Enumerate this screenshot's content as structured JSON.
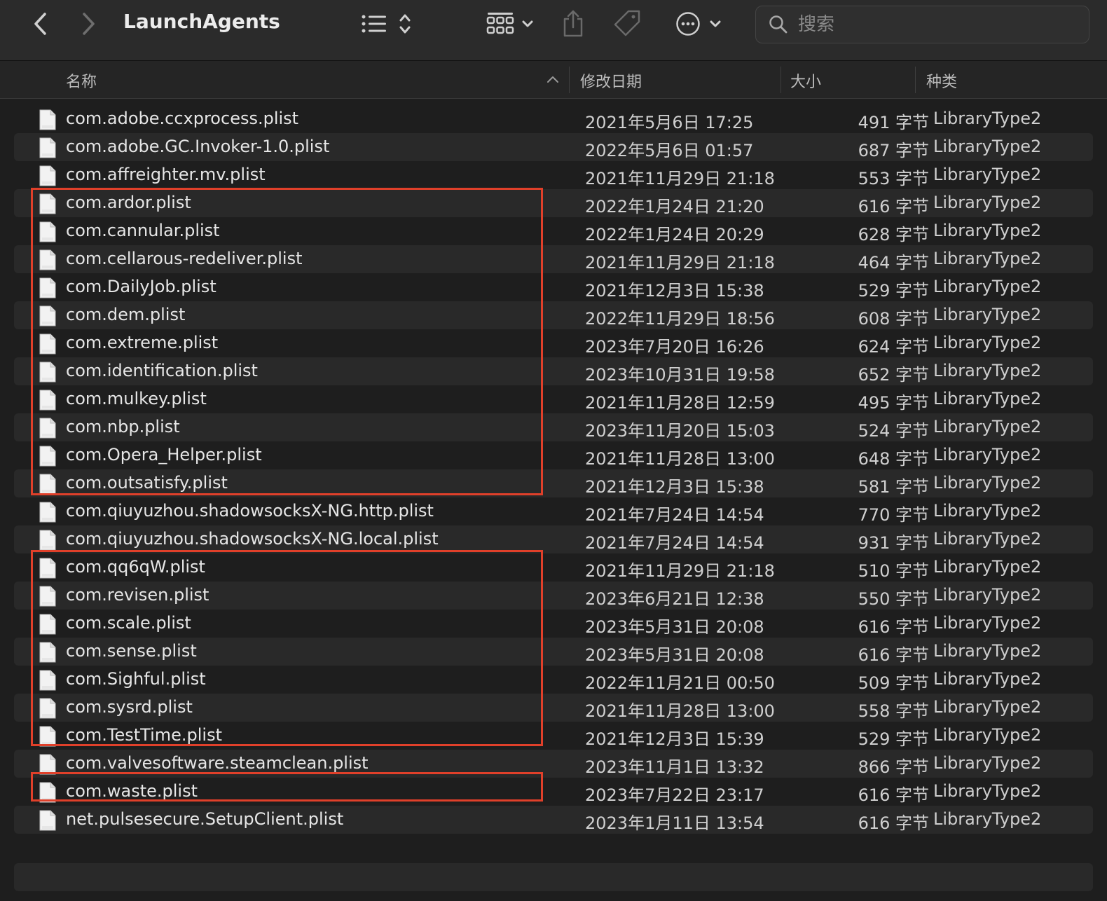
{
  "window": {
    "title": "LaunchAgents"
  },
  "icons": {
    "back": "chevron-left-icon",
    "forward": "chevron-right-icon",
    "list_view": "list-icon",
    "sort": "updown-chevron-icon",
    "grid": "grid-icon",
    "share": "share-icon",
    "tag": "tag-icon",
    "more": "ellipsis-circle-icon",
    "search": "search-icon",
    "file": "plist-file-icon"
  },
  "search": {
    "placeholder": "搜索",
    "value": ""
  },
  "columns": {
    "name": "名称",
    "modified": "修改日期",
    "size": "大小",
    "kind": "种类"
  },
  "files": [
    {
      "name": "com.adobe.ccxprocess.plist",
      "date": "2021年5月6日 17:25",
      "size": "491 字节",
      "kind": "LibraryType2"
    },
    {
      "name": "com.adobe.GC.Invoker-1.0.plist",
      "date": "2022年5月6日 01:57",
      "size": "687 字节",
      "kind": "LibraryType2"
    },
    {
      "name": "com.affreighter.mv.plist",
      "date": "2021年11月29日 21:18",
      "size": "553 字节",
      "kind": "LibraryType2"
    },
    {
      "name": "com.ardor.plist",
      "date": "2022年1月24日 21:20",
      "size": "616 字节",
      "kind": "LibraryType2"
    },
    {
      "name": "com.cannular.plist",
      "date": "2022年1月24日 20:29",
      "size": "628 字节",
      "kind": "LibraryType2"
    },
    {
      "name": "com.cellarous-redeliver.plist",
      "date": "2021年11月29日 21:18",
      "size": "464 字节",
      "kind": "LibraryType2"
    },
    {
      "name": "com.DailyJob.plist",
      "date": "2021年12月3日 15:38",
      "size": "529 字节",
      "kind": "LibraryType2"
    },
    {
      "name": "com.dem.plist",
      "date": "2022年11月29日 18:56",
      "size": "608 字节",
      "kind": "LibraryType2"
    },
    {
      "name": "com.extreme.plist",
      "date": "2023年7月20日 16:26",
      "size": "624 字节",
      "kind": "LibraryType2"
    },
    {
      "name": "com.identification.plist",
      "date": "2023年10月31日 19:58",
      "size": "652 字节",
      "kind": "LibraryType2"
    },
    {
      "name": "com.mulkey.plist",
      "date": "2021年11月28日 12:59",
      "size": "495 字节",
      "kind": "LibraryType2"
    },
    {
      "name": "com.nbp.plist",
      "date": "2023年11月20日 15:03",
      "size": "524 字节",
      "kind": "LibraryType2"
    },
    {
      "name": "com.Opera_Helper.plist",
      "date": "2021年11月28日 13:00",
      "size": "648 字节",
      "kind": "LibraryType2"
    },
    {
      "name": "com.outsatisfy.plist",
      "date": "2021年12月3日 15:38",
      "size": "581 字节",
      "kind": "LibraryType2"
    },
    {
      "name": "com.qiuyuzhou.shadowsocksX-NG.http.plist",
      "date": "2021年7月24日 14:54",
      "size": "770 字节",
      "kind": "LibraryType2"
    },
    {
      "name": "com.qiuyuzhou.shadowsocksX-NG.local.plist",
      "date": "2021年7月24日 14:54",
      "size": "931 字节",
      "kind": "LibraryType2"
    },
    {
      "name": "com.qq6qW.plist",
      "date": "2021年11月29日 21:18",
      "size": "510 字节",
      "kind": "LibraryType2"
    },
    {
      "name": "com.revisen.plist",
      "date": "2023年6月21日 12:38",
      "size": "550 字节",
      "kind": "LibraryType2"
    },
    {
      "name": "com.scale.plist",
      "date": "2023年5月31日 20:08",
      "size": "616 字节",
      "kind": "LibraryType2"
    },
    {
      "name": "com.sense.plist",
      "date": "2023年5月31日 20:08",
      "size": "616 字节",
      "kind": "LibraryType2"
    },
    {
      "name": "com.Sighful.plist",
      "date": "2022年11月21日 00:50",
      "size": "509 字节",
      "kind": "LibraryType2"
    },
    {
      "name": "com.sysrd.plist",
      "date": "2021年11月28日 13:00",
      "size": "558 字节",
      "kind": "LibraryType2"
    },
    {
      "name": "com.TestTime.plist",
      "date": "2021年12月3日 15:39",
      "size": "529 字节",
      "kind": "LibraryType2"
    },
    {
      "name": "com.valvesoftware.steamclean.plist",
      "date": "2023年11月1日 13:32",
      "size": "866 字节",
      "kind": "LibraryType2"
    },
    {
      "name": "com.waste.plist",
      "date": "2023年7月22日 23:17",
      "size": "616 字节",
      "kind": "LibraryType2"
    },
    {
      "name": "net.pulsesecure.SetupClient.plist",
      "date": "2023年1月11日 13:54",
      "size": "616 字节",
      "kind": "LibraryType2"
    }
  ],
  "annotations": {
    "color": "#e0402a"
  }
}
